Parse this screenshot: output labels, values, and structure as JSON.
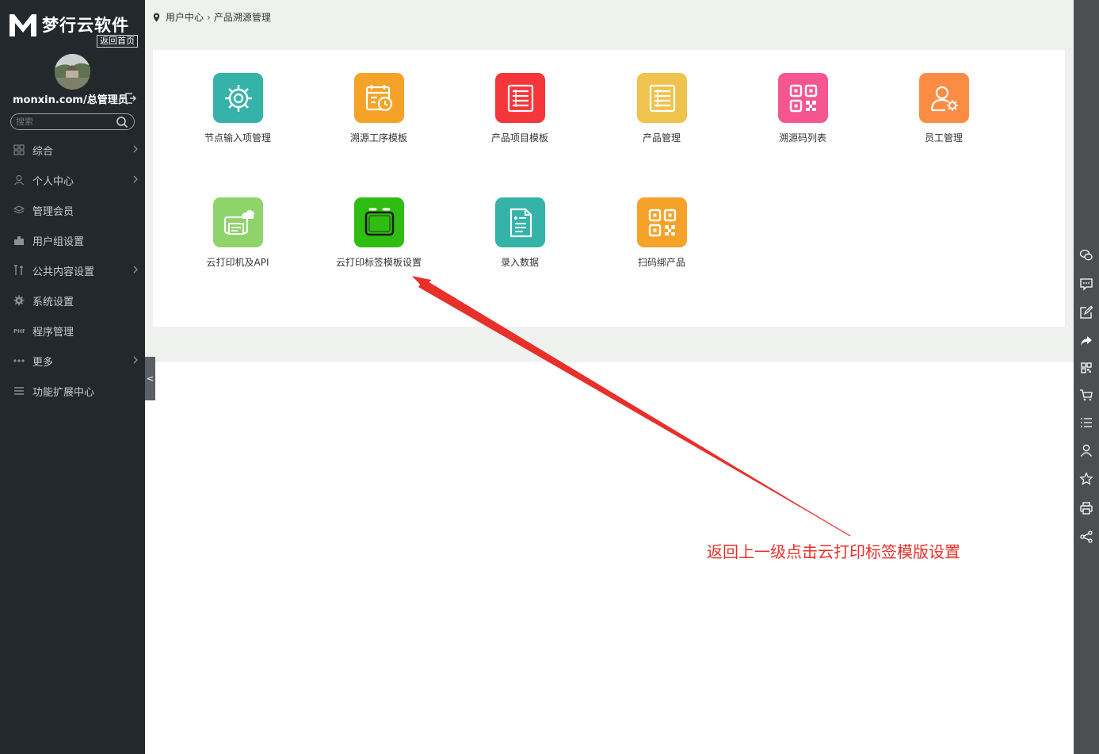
{
  "brand": {
    "name": "梦行云软件",
    "home_link": "返回首页"
  },
  "user": {
    "name": "monxin.com/总管理员"
  },
  "search": {
    "placeholder": "搜索"
  },
  "sidebar": {
    "items": [
      {
        "label": "综合",
        "icon": "grid-icon",
        "has_submenu": true
      },
      {
        "label": "个人中心",
        "icon": "user-icon",
        "has_submenu": true
      },
      {
        "label": "管理会员",
        "icon": "layers-icon",
        "has_submenu": false
      },
      {
        "label": "用户组设置",
        "icon": "building-icon",
        "has_submenu": false
      },
      {
        "label": "公共内容设置",
        "icon": "tools-icon",
        "has_submenu": true
      },
      {
        "label": "系统设置",
        "icon": "gear-icon",
        "has_submenu": false
      },
      {
        "label": "程序管理",
        "icon": "php-icon",
        "has_submenu": false
      },
      {
        "label": "更多",
        "icon": "dots-icon",
        "has_submenu": true
      },
      {
        "label": "功能扩展中心",
        "icon": "menu-icon",
        "has_submenu": false
      }
    ],
    "collapse_label": "<"
  },
  "breadcrumb": {
    "items": [
      "用户中心",
      "产品溯源管理"
    ],
    "separator": "›"
  },
  "apps": [
    {
      "label": "节点输入项管理",
      "color": "#35b3a8",
      "icon": "gear-icon"
    },
    {
      "label": "溯源工序模板",
      "color": "#f5a229",
      "icon": "calendar-clock-icon"
    },
    {
      "label": "产品项目模板",
      "color": "#f5363a",
      "icon": "list-icon"
    },
    {
      "label": "产品管理",
      "color": "#f0c24e",
      "icon": "list-icon"
    },
    {
      "label": "溯源码列表",
      "color": "#f5568f",
      "icon": "qrcode-icon"
    },
    {
      "label": "员工管理",
      "color": "#fb8c43",
      "icon": "user-gear-icon"
    },
    {
      "label": "云打印机及API",
      "color": "#8fd36b",
      "icon": "printer-cloud-icon"
    },
    {
      "label": "云打印标签模板设置",
      "color": "#2ebd10",
      "icon": "label-template-icon"
    },
    {
      "label": "录入数据",
      "color": "#35b3a8",
      "icon": "document-icon"
    },
    {
      "label": "扫码绑产品",
      "color": "#f5a229",
      "icon": "qrcode-icon"
    }
  ],
  "annotation": {
    "text": "返回上一级点击云打印标签模版设置",
    "color": "#e8302a"
  },
  "right_toolbar": [
    "wechat-icon",
    "message-icon",
    "edit-icon",
    "share-arrow-icon",
    "qrcode-icon",
    "cart-icon",
    "list-icon",
    "user-icon",
    "star-icon",
    "print-icon",
    "share-icon"
  ]
}
